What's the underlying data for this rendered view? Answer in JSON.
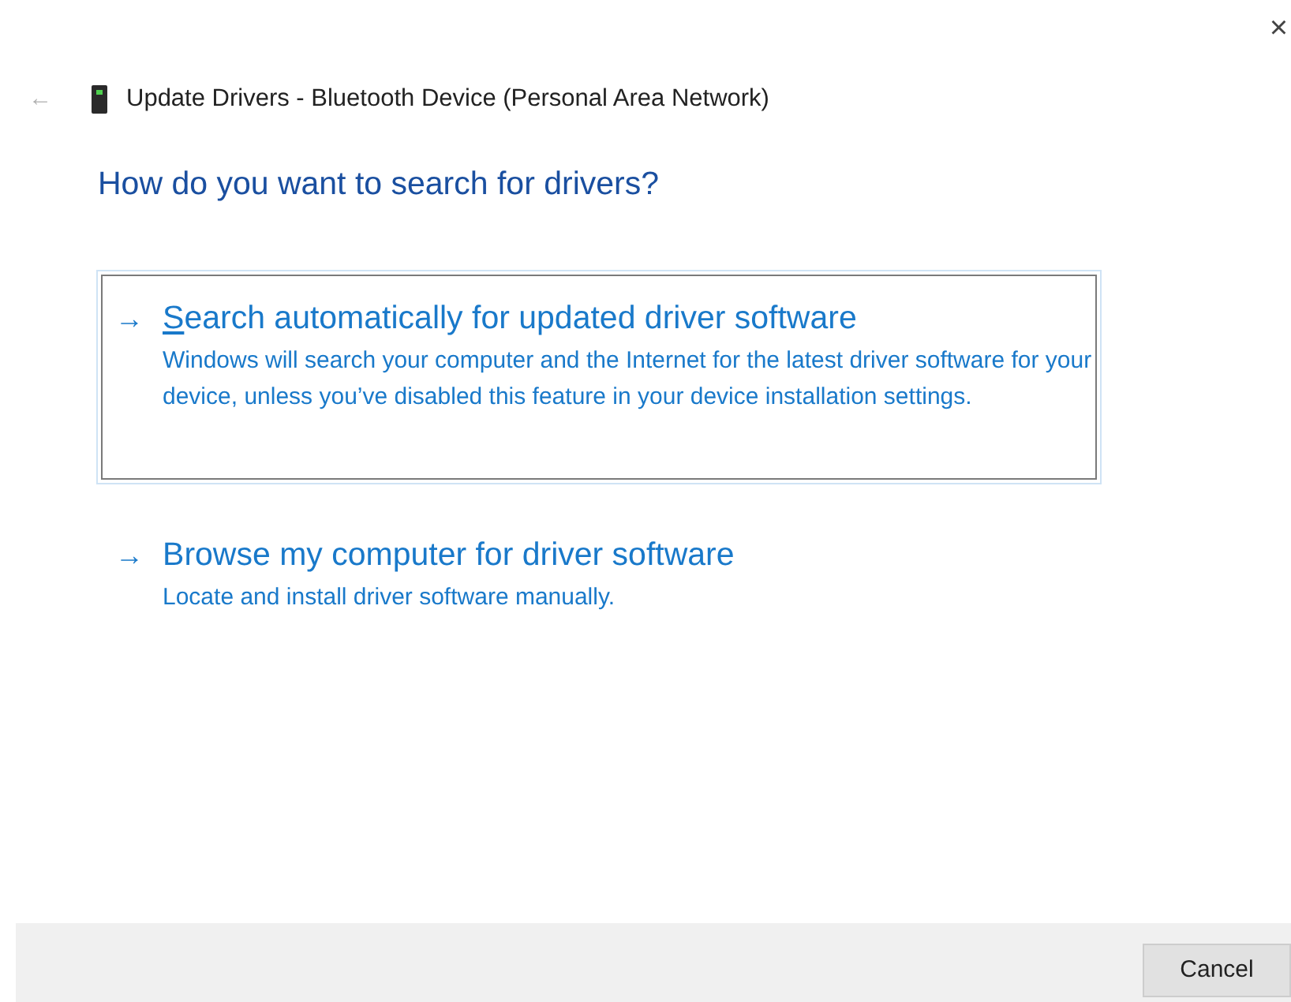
{
  "window": {
    "title": "Update Drivers - Bluetooth Device (Personal Area Network)",
    "close_glyph": "×"
  },
  "back": {
    "glyph": "←",
    "disabled": true
  },
  "heading": "How do you want to search for drivers?",
  "options": [
    {
      "arrow": "→",
      "title": "Search automatically for updated driver software",
      "description": "Windows will search your computer and the Internet for the latest driver software for your device, unless you’ve disabled this feature in your device installation settings.",
      "focused": true
    },
    {
      "arrow": "→",
      "title": "Browse my computer for driver software",
      "description": "Locate and install driver software manually.",
      "focused": false
    }
  ],
  "buttons": [
    "Cancel"
  ]
}
